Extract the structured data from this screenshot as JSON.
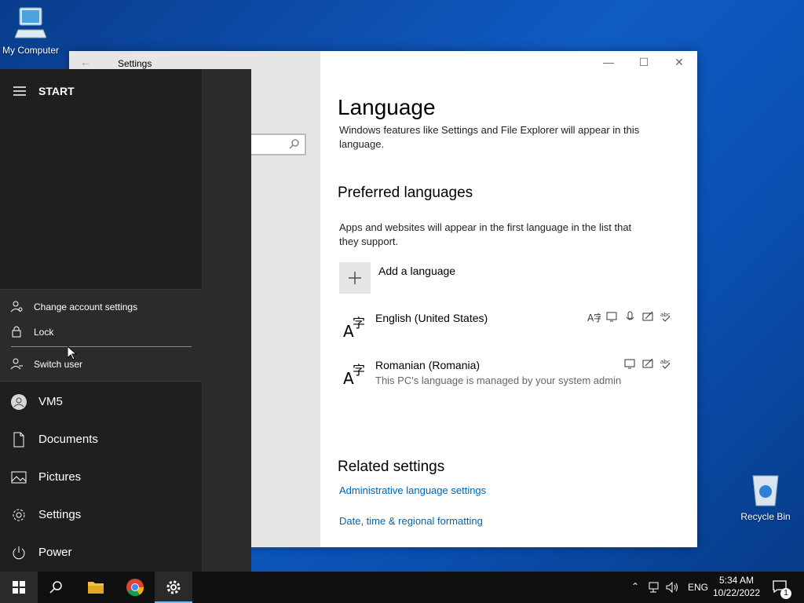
{
  "desktop": {
    "my_computer_label": "My Computer",
    "recycle_bin_label": "Recycle Bin"
  },
  "settings_window": {
    "title": "Settings",
    "page_title": "Language",
    "intro_text_line1": "Windows features like Settings and File Explorer will appear in this",
    "intro_text_line2": "language.",
    "preferred_heading": "Preferred languages",
    "preferred_desc_line1": "Apps and websites will appear in the first language in the list that",
    "preferred_desc_line2": "they support.",
    "add_language_label": "Add a language",
    "languages": [
      {
        "name": "English (United States)",
        "note": "",
        "features": [
          "display-language-icon",
          "text-to-speech-icon",
          "speech-recognition-icon",
          "handwriting-icon",
          "spell-check-icon"
        ]
      },
      {
        "name": "Romanian (Romania)",
        "note": "This PC's language is managed by your system admin",
        "features": [
          "text-to-speech-icon",
          "handwriting-icon",
          "spell-check-icon"
        ]
      }
    ],
    "related_heading": "Related settings",
    "related_links": [
      "Administrative language settings",
      "Date, time & regional formatting"
    ]
  },
  "start_menu": {
    "header": "START",
    "account_menu": [
      "Change account settings",
      "Lock",
      "Switch user"
    ],
    "items": [
      "VM5",
      "Documents",
      "Pictures",
      "Settings",
      "Power"
    ]
  },
  "taskbar": {
    "language": "ENG",
    "time": "5:34 AM",
    "date": "10/22/2022",
    "notification_count": "1"
  },
  "colors": {
    "accent_link": "#0063b1",
    "start_bg": "#1f1f1f",
    "taskbar_bg": "#101010"
  }
}
